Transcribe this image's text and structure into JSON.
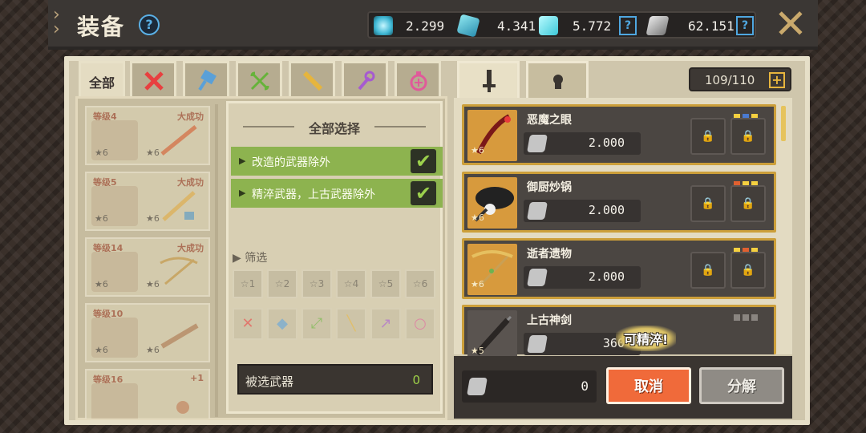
{
  "header": {
    "title": "装备",
    "currencies": [
      {
        "icon": "energy-crystal-icon",
        "value": "2.299"
      },
      {
        "icon": "blue-gem-icon",
        "value": "4.341"
      },
      {
        "icon": "cyan-gem-icon",
        "value": "5.772"
      },
      {
        "icon": "metal-ore-icon",
        "value": "62.151"
      }
    ]
  },
  "category_tabs": [
    {
      "label": "全部",
      "icon": "all-tab",
      "active": true
    },
    {
      "label": "",
      "icon": "sword-icon",
      "color": "#e84040"
    },
    {
      "label": "",
      "icon": "hammer-icon",
      "color": "#5aa0d8"
    },
    {
      "label": "",
      "icon": "bow-icon",
      "color": "#66b33a"
    },
    {
      "label": "",
      "icon": "gun-icon",
      "color": "#e6b53d"
    },
    {
      "label": "",
      "icon": "staff-icon",
      "color": "#a65ad0"
    },
    {
      "label": "",
      "icon": "accessory-icon",
      "color": "#e05a9a"
    }
  ],
  "weapon_list": [
    {
      "level": "等级4",
      "tag": "大成功",
      "star1": "★6",
      "star2": "★6"
    },
    {
      "level": "等级5",
      "tag": "大成功",
      "star1": "★6",
      "star2": "★6"
    },
    {
      "level": "等级14",
      "tag": "大成功",
      "star1": "★6",
      "star2": "★6"
    },
    {
      "level": "等级10",
      "tag": "",
      "star1": "★6",
      "star2": "★6"
    },
    {
      "level": "等级16",
      "tag": "+1",
      "star1": "",
      "star2": ""
    }
  ],
  "filter": {
    "select_all": "全部选择",
    "options": [
      {
        "label": "改造的武器除外",
        "checked": true
      },
      {
        "label": "精淬武器，上古武器除外",
        "checked": true
      }
    ],
    "filter_label": "筛选",
    "star_buttons": [
      "1",
      "2",
      "3",
      "4",
      "5",
      "6"
    ],
    "selected_label": "被选武器",
    "selected_count": "0"
  },
  "right_tabs": [
    {
      "icon": "weapon-tab-icon",
      "active": true
    },
    {
      "icon": "armor-tab-icon",
      "active": false
    }
  ],
  "inventory_count": "109/110",
  "items": [
    {
      "name": "恶魔之眼",
      "stars": "★6",
      "price": "2.000",
      "dots": [
        "#f5d040",
        "#4a7ad0",
        "#f5d040"
      ],
      "thumb_color": "#d79a3d"
    },
    {
      "name": "御厨炒锅",
      "stars": "★6",
      "price": "2.000",
      "dots": [
        "#e06030",
        "#f5d040",
        "#f5d040"
      ],
      "thumb_color": "#d79a3d"
    },
    {
      "name": "逝者遗物",
      "stars": "★6",
      "price": "2.000",
      "dots": [
        "#f5d040",
        "#e06030",
        "#f5d040"
      ],
      "thumb_color": "#d79a3d"
    },
    {
      "name": "上古神剑",
      "stars": "★5",
      "price": "360",
      "dots": [
        "#8a8580",
        "#8a8580",
        "#8a8580"
      ],
      "thumb_color": "#5a5450"
    }
  ],
  "refine_badge": "可精淬!",
  "bottom": {
    "amount": "0",
    "cancel_label": "取消",
    "decompose_label": "分解"
  },
  "colors": {
    "accent_green": "#8db34f",
    "cancel_orange": "#f06a3a",
    "item_border": "#cc9f3a"
  }
}
